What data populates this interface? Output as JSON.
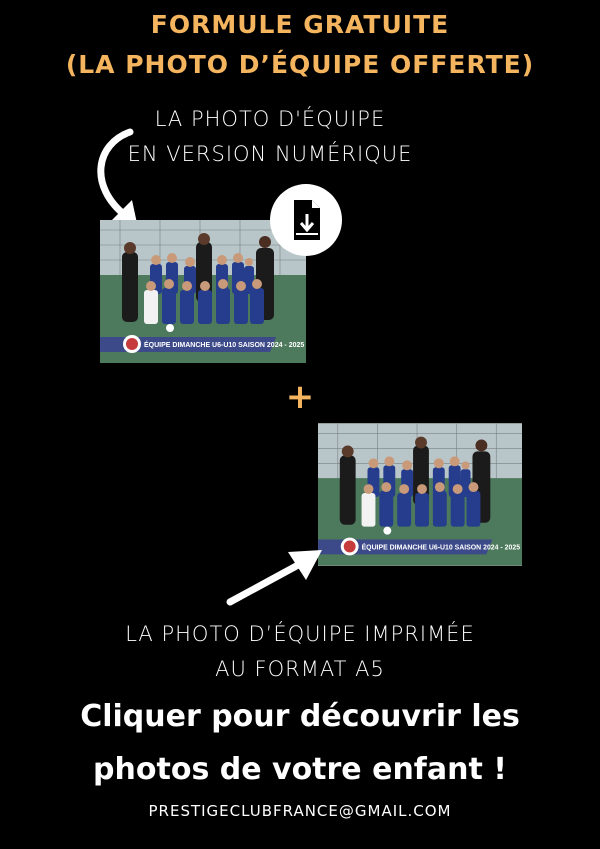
{
  "header": {
    "line1": "FORMULE GRATUITE",
    "line2": "(LA PHOTO D’ÉQUIPE OFFERTE)"
  },
  "digital": {
    "caption_line1": "LA PHOTO D'ÉQUIPE",
    "caption_line2": "EN VERSION NUMÉRIQUE",
    "icon": "file-download-icon"
  },
  "plus_sign": "+",
  "printed": {
    "caption_line1": "LA PHOTO D’ÉQUIPE IMPRIMÉE",
    "caption_line2": "AU FORMAT A5"
  },
  "photo_banner": "ÉQUIPE DIMANCHE U6-U10 SAISON 2024 - 2025",
  "cta": {
    "line1": "Cliquer pour découvrir les",
    "line2": "photos de votre enfant !"
  },
  "email": "PRESTIGECLUBFRANCE@GMAIL.COM",
  "colors": {
    "accent": "#f5b55f",
    "background": "#000000",
    "text": "#ffffff",
    "banner": "#3d4a8a"
  }
}
